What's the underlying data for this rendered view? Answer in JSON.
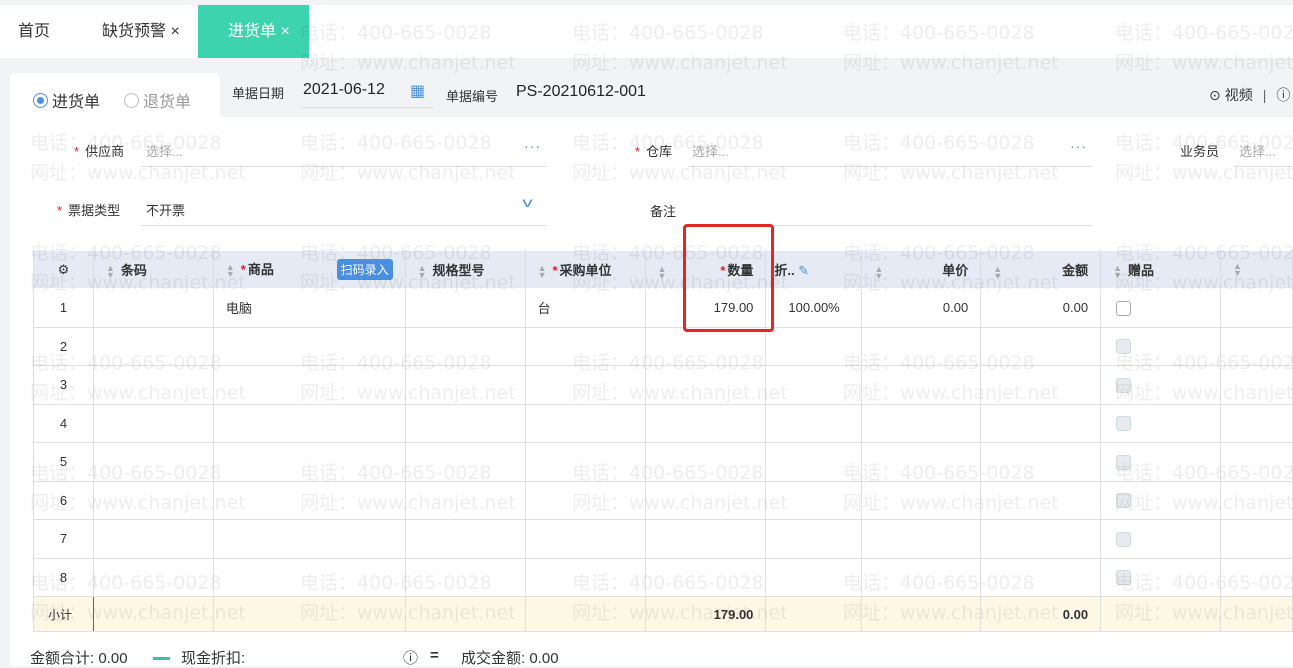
{
  "tabs": [
    {
      "label": "首页",
      "closable": false
    },
    {
      "label": "缺货预警",
      "closable": true
    },
    {
      "label": "进货单",
      "closable": true,
      "active": true
    }
  ],
  "close_glyph": "×",
  "bill_type": {
    "options": [
      "进货单",
      "退货单"
    ],
    "selected": "进货单"
  },
  "date": {
    "label": "单据日期",
    "value": "2021-06-12"
  },
  "bill_no": {
    "label": "单据编号",
    "value": "PS-20210612-001"
  },
  "help": {
    "video_label": "视频"
  },
  "form": {
    "supplier": {
      "label": "供应商",
      "placeholder": "选择..."
    },
    "warehouse": {
      "label": "仓库",
      "placeholder": "选择..."
    },
    "salesman": {
      "label": "业务员",
      "placeholder": "选择..."
    },
    "invoice_type": {
      "label": "票据类型",
      "value": "不开票"
    },
    "remark": {
      "label": "备注",
      "value": ""
    }
  },
  "table": {
    "headers": {
      "barcode": "条码",
      "product": "商品",
      "scan": "扫码录入",
      "spec": "规格型号",
      "unit": "采购单位",
      "qty": "数量",
      "discount": "折..",
      "price": "单价",
      "amount": "金额",
      "gift": "赠品"
    },
    "rows": [
      {
        "no": "1",
        "product": "电脑",
        "unit": "台",
        "qty": "179.00",
        "discount": "100.00%",
        "price": "0.00",
        "amount": "0.00"
      },
      {
        "no": "2"
      },
      {
        "no": "3"
      },
      {
        "no": "4"
      },
      {
        "no": "5"
      },
      {
        "no": "6"
      },
      {
        "no": "7"
      },
      {
        "no": "8"
      }
    ],
    "subtotal": {
      "label": "小计",
      "qty": "179.00",
      "amount": "0.00"
    }
  },
  "footer": {
    "total_label": "金额合计:",
    "total": "0.00",
    "cash_discount_label": "现金折扣:",
    "deal_label": "成交金额:",
    "deal": "0.00"
  },
  "watermark": {
    "phone": "电话：400-665-0028",
    "site": "网址：www.chanjet.net"
  },
  "colors": {
    "active_tab": "#3dd3ae",
    "accent": "#4a90e2",
    "highlight": "#e82424",
    "subtotal_bg": "#fdf7e6"
  }
}
